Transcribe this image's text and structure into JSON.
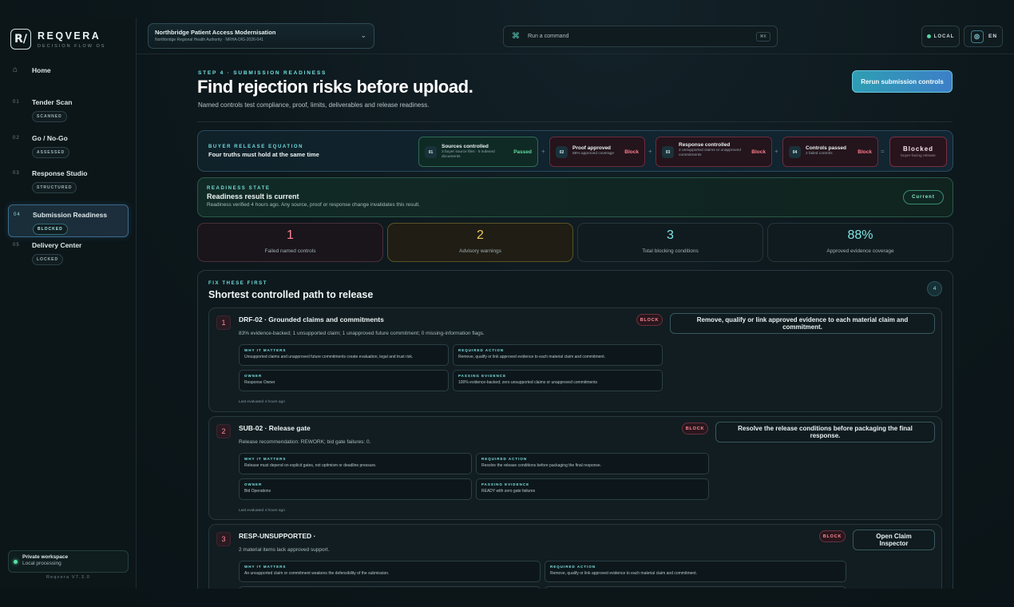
{
  "brand": {
    "logo_text": "R/",
    "name": "REQVERA",
    "sub": "DECISION FLOW OS"
  },
  "nav": {
    "home": {
      "icon": "home-icon",
      "label": "Home"
    },
    "items": [
      {
        "num": "01",
        "label": "Tender Scan",
        "badge": "SCANNED"
      },
      {
        "num": "02",
        "label": "Go / No-Go",
        "badge": "ASSESSED"
      },
      {
        "num": "03",
        "label": "Response Studio",
        "badge": "STRUCTURED"
      },
      {
        "num": "04",
        "label": "Submission Readiness",
        "badge": "BLOCKED"
      },
      {
        "num": "05",
        "label": "Delivery Center",
        "badge": "LOCKED"
      }
    ]
  },
  "workspace": {
    "title": "Private workspace",
    "sub": "Local processing",
    "version": "Reqvera V7.3.0"
  },
  "header": {
    "project_title": "Northbridge Patient Access Modernisation",
    "project_sub": "Northbridge Regional Health Authority · NRHA-DIG-2026-041",
    "command_placeholder": "Run a command",
    "command_kbd": "⌘K",
    "mode": "LOCAL",
    "lang": "EN"
  },
  "page": {
    "step": "STEP 4 · SUBMISSION READINESS",
    "title": "Find rejection risks before upload.",
    "lead": "Named controls test compliance, proof, limits, deliverables and release readiness.",
    "rerun": "Rerun submission controls"
  },
  "equation": {
    "kicker": "BUYER RELEASE EQUATION",
    "title": "Four truths must hold at the same time",
    "terms": [
      {
        "n": "01",
        "title": "Sources controlled",
        "sub": "3 buyer source files · 5 indexed documents",
        "status": "Passed"
      },
      {
        "n": "02",
        "title": "Proof approved",
        "sub": "88% approved coverage",
        "status": "Block"
      },
      {
        "n": "03",
        "title": "Response controlled",
        "sub": "2 unsupported claims or unapproved commitments",
        "status": "Block"
      },
      {
        "n": "04",
        "title": "Controls passed",
        "sub": "2 failed controls",
        "status": "Block"
      }
    ],
    "ops": [
      "+",
      "+",
      "+",
      "="
    ],
    "result": {
      "title": "Blocked",
      "sub": "buyer-facing release"
    }
  },
  "state": {
    "kicker": "READINESS STATE",
    "title": "Readiness result is current",
    "sub": "Readiness verified 4 hours ago. Any source, proof or response change invalidates this result.",
    "pill": "Current"
  },
  "metrics": [
    {
      "value": "1",
      "label": "Failed named controls"
    },
    {
      "value": "2",
      "label": "Advisory warnings"
    },
    {
      "value": "3",
      "label": "Total blocking conditions"
    },
    {
      "value": "88%",
      "label": "Approved evidence coverage"
    }
  ],
  "fix": {
    "kicker": "FIX THESE FIRST",
    "title": "Shortest controlled path to release",
    "count": "4",
    "items": [
      {
        "idx": "1",
        "title": "DRF-02 · Grounded claims and commitments",
        "summary": "83% evidence-backed; 1 unsupported claim; 1 unapproved future commitment; 0 missing-information flags.",
        "badge": "BLOCK",
        "action": "Remove, qualify or link approved evidence to each material claim and commitment.",
        "why_k": "WHY IT MATTERS",
        "why": "Unsupported claims and unapproved future commitments create evaluation, legal and trust risk.",
        "req_k": "REQUIRED ACTION",
        "req": "Remove, qualify or link approved evidence to each material claim and commitment.",
        "own_k": "OWNER",
        "own": "Response Owner",
        "pass_k": "PASSING EVIDENCE",
        "pass": "100% evidence-backed; zero unsupported claims or unapproved commitments",
        "eval": "Last evaluated 4 hours ago"
      },
      {
        "idx": "2",
        "title": "SUB-02 · Release gate",
        "summary": "Release recommendation: REWORK; bid gate failures: 0.",
        "badge": "BLOCK",
        "action": "Resolve the release conditions before packaging the final response.",
        "why_k": "WHY IT MATTERS",
        "why": "Release must depend on explicit gates, not optimism or deadline pressure.",
        "req_k": "REQUIRED ACTION",
        "req": "Resolve the release conditions before packaging the final response.",
        "own_k": "OWNER",
        "own": "Bid Operations",
        "pass_k": "PASSING EVIDENCE",
        "pass": "READY with zero gate failures",
        "eval": "Last evaluated 4 hours ago"
      },
      {
        "idx": "3",
        "title": "RESP-UNSUPPORTED ·",
        "summary": "2 material items lack approved support.",
        "badge": "BLOCK",
        "action": "Open Claim Inspector",
        "why_k": "WHY IT MATTERS",
        "why": "An unsupported claim or commitment weakens the defensibility of the submission.",
        "req_k": "REQUIRED ACTION",
        "req": "Remove, qualify or link approved evidence to each material claim and commitment."
      }
    ]
  }
}
